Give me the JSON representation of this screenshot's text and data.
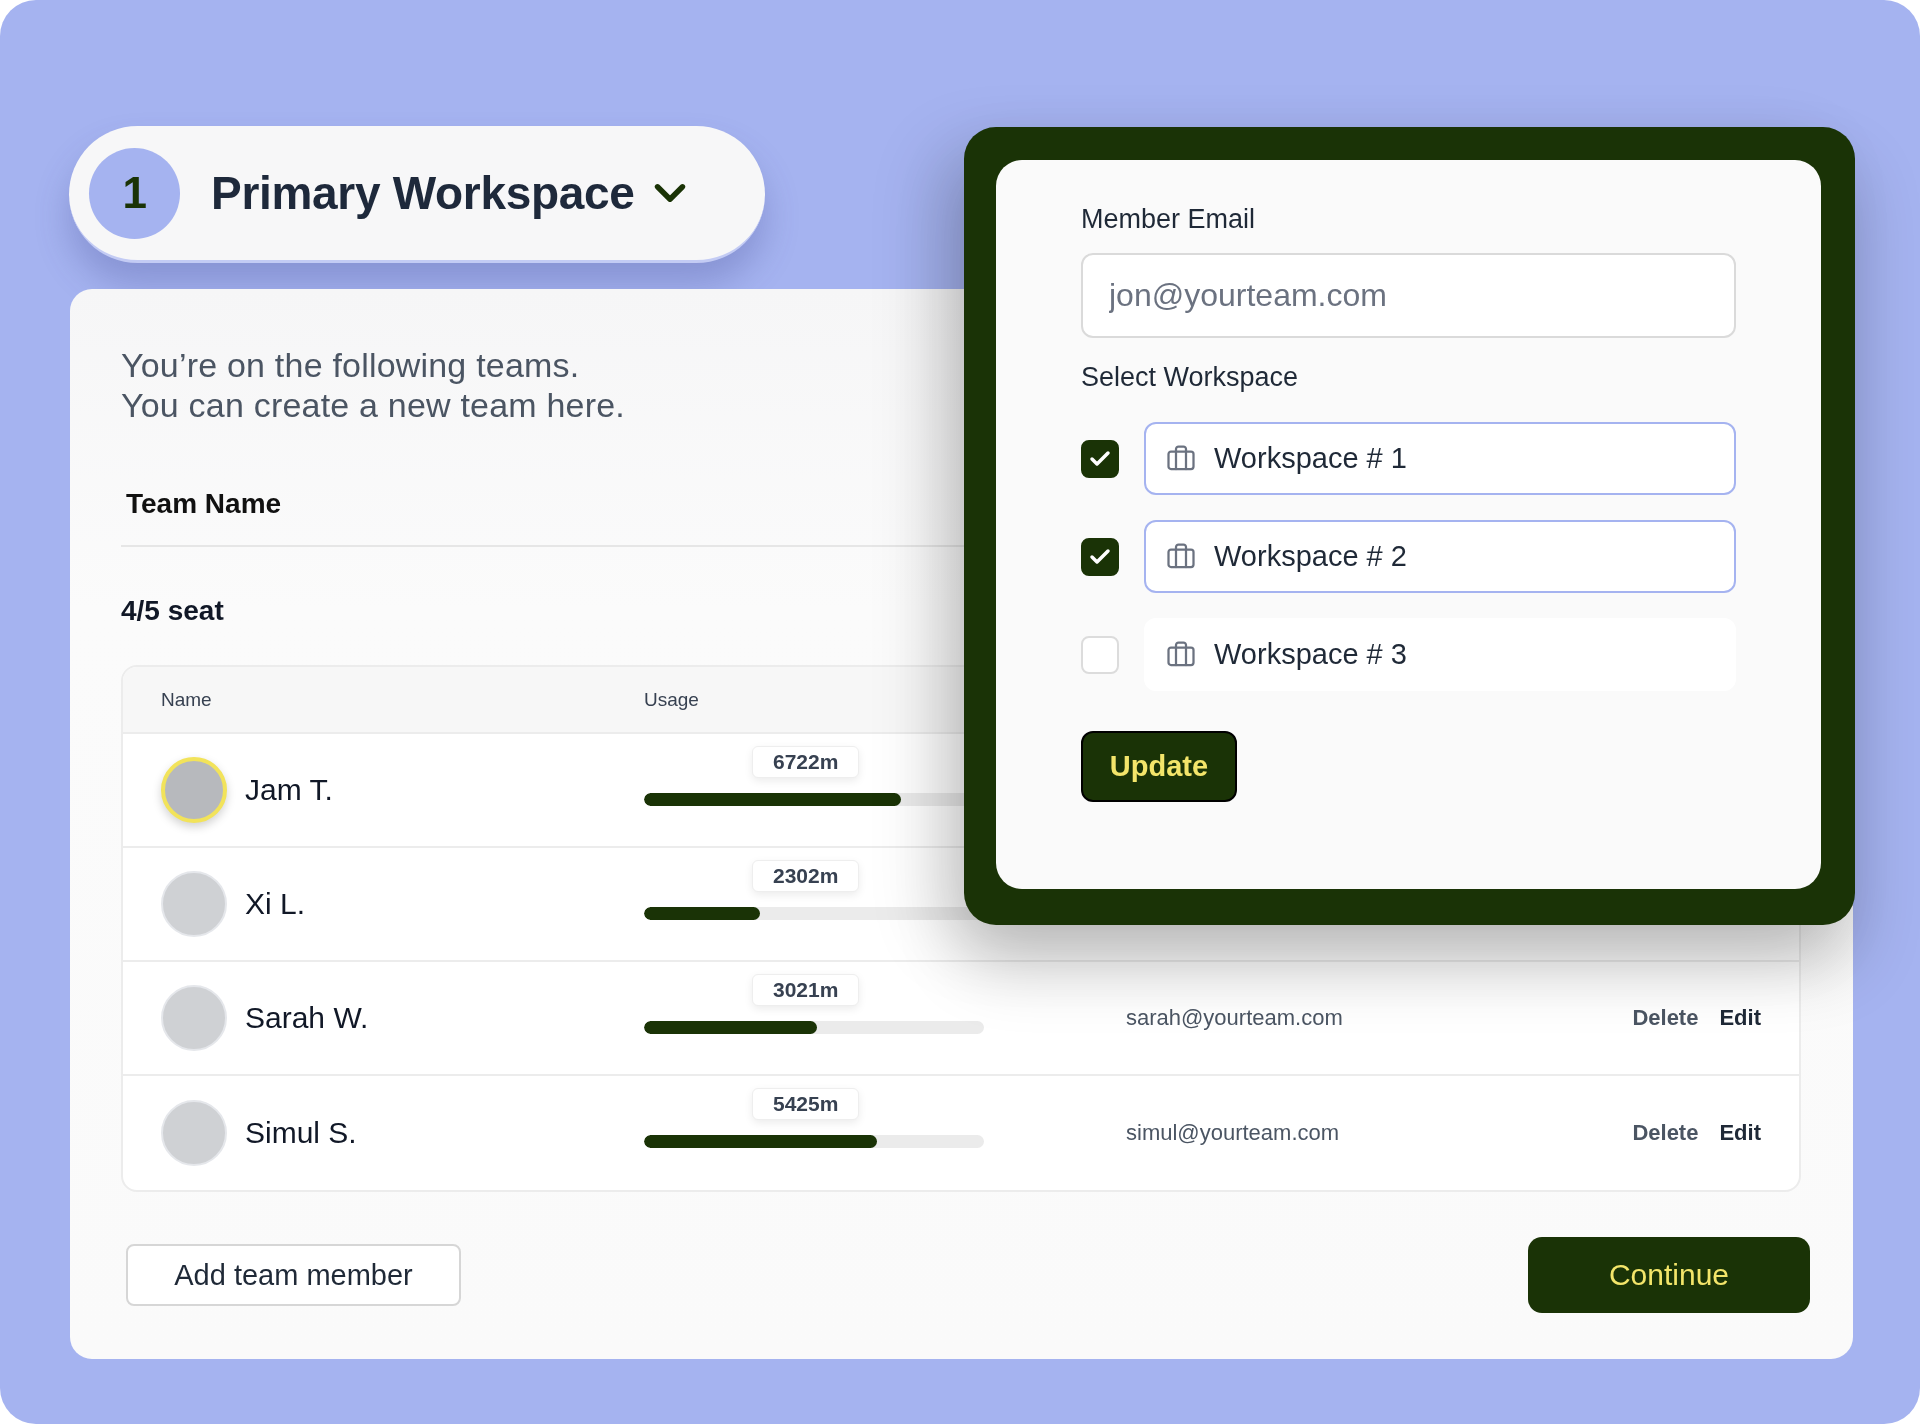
{
  "workspace_switcher": {
    "number": "1",
    "title": "Primary Workspace"
  },
  "intro": [
    "You’re on the following teams.",
    "You can create a new team here."
  ],
  "team_name_label": "Team Name",
  "seats": "4/5 seat",
  "table": {
    "columns": [
      "Name",
      "Usage"
    ],
    "rows": [
      {
        "name": "Jam T.",
        "highlighted": true,
        "usage": "6722m",
        "level": 0.755
      },
      {
        "name": "Xi L.",
        "highlighted": false,
        "usage": "2302m",
        "level": 0.34
      },
      {
        "name": "Sarah W.",
        "highlighted": false,
        "usage": "3021m",
        "level": 0.51,
        "email": "sarah@yourteam.com",
        "actions": [
          {
            "label": "Delete",
            "kind": "delete"
          },
          {
            "label": "Edit",
            "kind": "edit"
          }
        ]
      },
      {
        "name": "Simul S.",
        "highlighted": false,
        "usage": "5425m",
        "level": 0.685,
        "email": "simul@yourteam.com",
        "actions": [
          {
            "label": "Delete",
            "kind": "delete"
          },
          {
            "label": "Edit",
            "kind": "edit"
          }
        ]
      }
    ]
  },
  "add_member_button": "Add team member",
  "continue_button": "Continue",
  "dialog": {
    "email_label": "Member Email",
    "email_field": {
      "placeholder": "jon@yourteam.com"
    },
    "workspace_label": "Select Workspace",
    "workspaces": [
      {
        "label": "Workspace # 1",
        "checked": true
      },
      {
        "label": "Workspace # 2",
        "checked": true
      },
      {
        "label": "Workspace # 3",
        "checked": false
      }
    ],
    "update_button": "Update"
  }
}
